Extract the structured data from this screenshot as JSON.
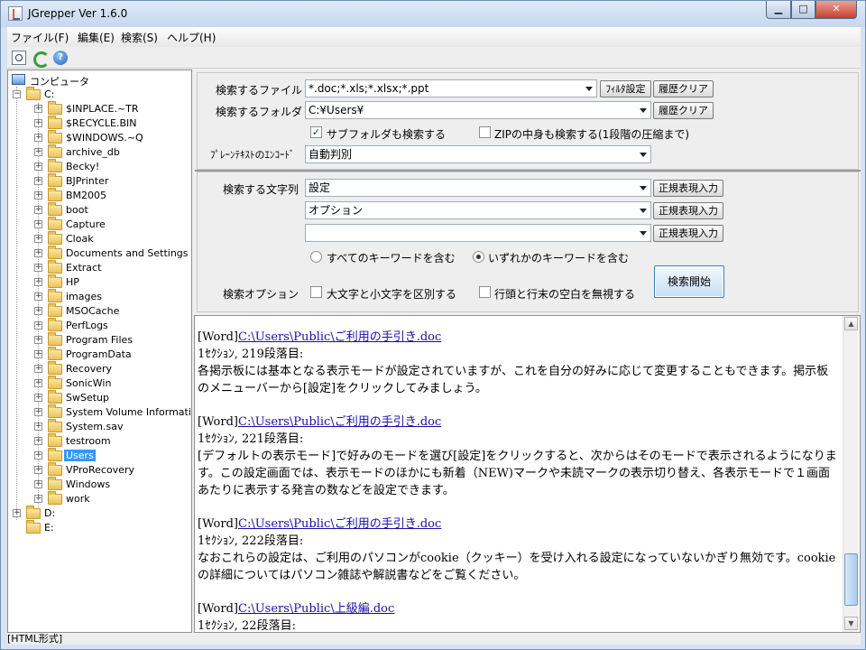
{
  "window": {
    "title": "JGrepper Ver 1.6.0"
  },
  "menu": [
    {
      "label": "ファイル(F)"
    },
    {
      "label": "編集(E)"
    },
    {
      "label": "検索(S)"
    },
    {
      "label": "ヘルプ(H)"
    }
  ],
  "tree": {
    "root": "コンピュータ",
    "drive_c": "C:",
    "folders": [
      "$INPLACE.~TR",
      "$RECYCLE.BIN",
      "$WINDOWS.~Q",
      "archive_db",
      "Becky!",
      "BJPrinter",
      "BM2005",
      "boot",
      "Capture",
      "Cloak",
      "Documents and Settings",
      "Extract",
      "HP",
      "images",
      "MSOCache",
      "PerfLogs",
      "Program Files",
      "ProgramData",
      "Recovery",
      "SonicWin",
      "SwSetup",
      "System Volume Information",
      "System.sav",
      "testroom",
      "Users",
      "VProRecovery",
      "Windows",
      "work"
    ],
    "selected": "Users",
    "drive_d": "D:",
    "drive_e": "E:"
  },
  "form": {
    "file_label": "検索するファイル",
    "file_value": "*.doc;*.xls;*.xlsx;*.ppt",
    "filter_button": "ﾌｨﾙﾀ設定",
    "clear_history_button": "履歴クリア",
    "folder_label": "検索するフォルダ",
    "folder_value": "C:¥Users¥",
    "subfolder_label": "サブフォルダも検索する",
    "zip_label": "ZIPの中身も検索する(1段階の圧縮まで)",
    "encoding_label": "ﾌﾟﾚｰﾝﾃｷｽﾄのｴﾝｺｰﾄﾞ",
    "encoding_value": "自動判別",
    "search_string_label": "検索する文字列",
    "keywords": [
      "設定",
      "オプション",
      ""
    ],
    "regex_button": "正規表現入力",
    "radio_all": "すべてのキーワードを含む",
    "radio_any": "いずれかのキーワードを含む",
    "options_label": "検索オプション",
    "case_label": "大文字と小文字を区別する",
    "trim_label": "行頭と行末の空白を無視する",
    "start_button": "検索開始"
  },
  "results": [
    {
      "tag": "[Word]",
      "path": "C:\\Users\\Public\\ご利用の手引き.doc",
      "location": "1ｾｸｼｮﾝ, 219段落目:",
      "lines": [
        "各掲示板には基本となる表示モードが設定されていますが、これを自分の好みに応じて変更することもできます。掲示板のメニューバーから[設定]をクリックしてみましょう。"
      ]
    },
    {
      "tag": "[Word]",
      "path": "C:\\Users\\Public\\ご利用の手引き.doc",
      "location": "1ｾｸｼｮﾝ, 221段落目:",
      "lines": [
        "[デフォルトの表示モード]で好みのモードを選び[設定]をクリックすると、次からはそのモードで表示されるようになります。この設定画面では、表示モードのほかにも新着（NEW)マークや未読マークの表示切り替え、各表示モードで１画面あたりに表示する発言の数などを設定できます。"
      ]
    },
    {
      "tag": "[Word]",
      "path": "C:\\Users\\Public\\ご利用の手引き.doc",
      "location": "1ｾｸｼｮﾝ, 222段落目:",
      "lines": [
        "なおこれらの設定は、ご利用のパソコンがcookie（クッキー）を受け入れる設定になっていないかぎり無効です。cookieの詳細についてはパソコン雑誌や解説書などをご覧ください。"
      ]
    },
    {
      "tag": "[Word]",
      "path": "C:\\Users\\Public\\上級編.doc",
      "location": "1ｾｸｼｮﾝ, 22段落目:",
      "lines": []
    }
  ],
  "status": {
    "text": "[HTML形式]"
  }
}
